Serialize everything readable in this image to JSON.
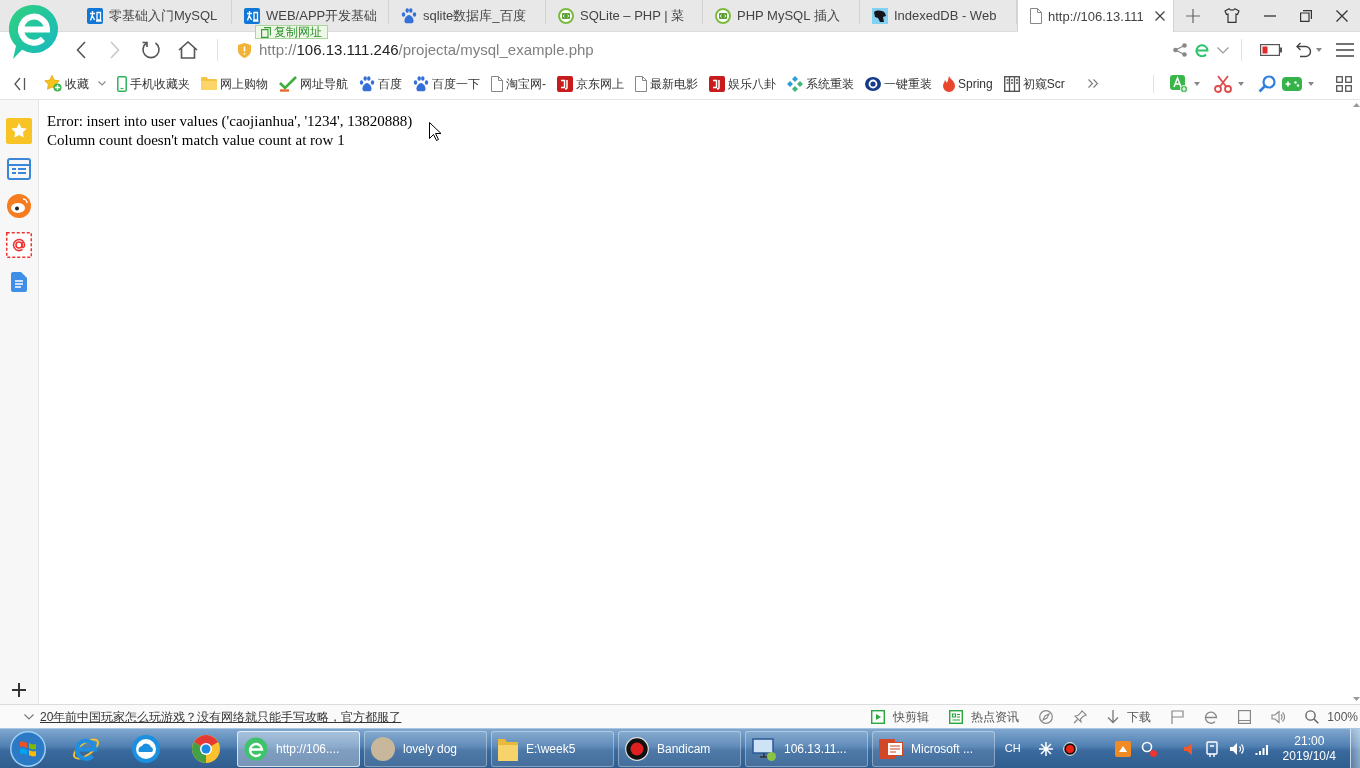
{
  "browser": {
    "tabs": [
      {
        "kind": "badge",
        "title": "零基础入门MySQL",
        "selected": false
      },
      {
        "kind": "badge",
        "title": "WEB/APP开发基础",
        "selected": false
      },
      {
        "kind": "paw",
        "title": "sqlite数据库_百度",
        "selected": false
      },
      {
        "kind": "code",
        "title": "SQLite – PHP | 菜",
        "selected": false
      },
      {
        "kind": "code",
        "title": "PHP MySQL 插入",
        "selected": false
      },
      {
        "kind": "animal",
        "title": "IndexedDB - Web",
        "selected": false
      },
      {
        "kind": "page",
        "title": "http://106.13.111",
        "selected": true
      }
    ],
    "copy_button": "复制网址",
    "nav_buttons": [
      {
        "kind": "back",
        "disabled": false
      },
      {
        "kind": "forward",
        "disabled": true
      },
      {
        "kind": "refresh",
        "disabled": false
      },
      {
        "kind": "home",
        "disabled": false
      }
    ],
    "address": {
      "scheme": "http://",
      "host": "106.13.111.246",
      "path": "/projecta/mysql_example.php"
    },
    "bookmarks": [
      {
        "kind": "star",
        "label": "收藏",
        "menu": true
      },
      {
        "kind": "phone",
        "label": "手机收藏夹",
        "menu": false
      },
      {
        "kind": "folder",
        "label": "网上购物",
        "menu": false
      },
      {
        "kind": "check",
        "label": "网址导航",
        "menu": false
      },
      {
        "kind": "paw",
        "label": "百度",
        "menu": false
      },
      {
        "kind": "paw",
        "label": "百度一下",
        "menu": false
      },
      {
        "kind": "page",
        "label": "淘宝网-",
        "menu": false
      },
      {
        "kind": "tile",
        "label": "京东网上",
        "menu": false
      },
      {
        "kind": "page",
        "label": "最新电影",
        "menu": false
      },
      {
        "kind": "tile",
        "label": "娱乐八卦",
        "menu": false
      },
      {
        "kind": "diamond",
        "label": "系统重装",
        "menu": false
      },
      {
        "kind": "eye",
        "label": "一键重装",
        "menu": false
      },
      {
        "kind": "flame",
        "label": "Spring",
        "menu": false
      },
      {
        "kind": "columns",
        "label": "初窥Scr",
        "menu": false
      }
    ]
  },
  "page": {
    "lines": [
      "Error: insert into user values ('caojianhua', '1234', 13820888)",
      "Column count doesn't match value count at row 1"
    ]
  },
  "status_bar": {
    "headline": "20年前中国玩家怎么玩游戏？没有网络就只能手写攻略，官方都服了",
    "tools": [
      {
        "kind": "clip",
        "label": "快剪辑"
      },
      {
        "kind": "news",
        "label": "热点资讯"
      },
      {
        "kind": "compass"
      },
      {
        "kind": "pin"
      },
      {
        "kind": "download",
        "label": "下载"
      },
      {
        "kind": "flag"
      },
      {
        "kind": "ie"
      },
      {
        "kind": "window"
      },
      {
        "kind": "speaker"
      },
      {
        "kind": "zoom",
        "label": "100%"
      }
    ]
  },
  "taskbar": {
    "tasks": [
      {
        "kind": "browser",
        "label": "http://106....",
        "selected": true
      },
      {
        "kind": "photo",
        "label": "lovely dog",
        "selected": false
      },
      {
        "kind": "folder",
        "label": "E:\\week5",
        "selected": false
      },
      {
        "kind": "record",
        "label": "Bandicam",
        "selected": false
      },
      {
        "kind": "monitor",
        "label": "106.13.11...",
        "selected": false
      },
      {
        "kind": "slides",
        "label": "Microsoft ...",
        "selected": false
      }
    ],
    "tray": {
      "language": "CH",
      "time": "21:00",
      "date": "2019/10/4"
    }
  }
}
